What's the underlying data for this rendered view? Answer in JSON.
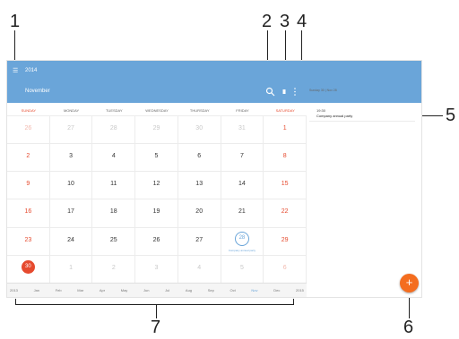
{
  "callouts": [
    "1",
    "2",
    "3",
    "4",
    "5",
    "6",
    "7"
  ],
  "app": {
    "menu_icon": "menu-icon",
    "year": "2014",
    "month": "November",
    "search_icon": "search-icon",
    "today_icon": "today-icon",
    "overflow_icon": "overflow-menu-icon",
    "accent_color": "#6aa5d9"
  },
  "calendar": {
    "weekdays": [
      "SUNDAY",
      "MONDAY",
      "TUESDAY",
      "WEDNESDAY",
      "THURSDAY",
      "FRIDAY",
      "SATURDAY"
    ],
    "weeks": [
      [
        "26",
        "27",
        "28",
        "29",
        "30",
        "31",
        "1"
      ],
      [
        "2",
        "3",
        "4",
        "5",
        "6",
        "7",
        "8"
      ],
      [
        "9",
        "10",
        "11",
        "12",
        "13",
        "14",
        "15"
      ],
      [
        "16",
        "17",
        "18",
        "19",
        "20",
        "21",
        "22"
      ],
      [
        "23",
        "24",
        "25",
        "26",
        "27",
        "28",
        "29"
      ],
      [
        "30",
        "1",
        "2",
        "3",
        "4",
        "5",
        "6"
      ]
    ],
    "today": "30",
    "event_day": "28",
    "event_short_label": "Company annual party"
  },
  "month_strip": [
    "2013",
    "Jan",
    "Feb",
    "Mar",
    "Apr",
    "May",
    "Jun",
    "Jul",
    "Aug",
    "Sep",
    "Oct",
    "Nov",
    "Dec",
    "2015"
  ],
  "side_panel": {
    "date_label": "Sunday 30 | Nov 28",
    "event_time": "19:30",
    "event_title": "Company annual party"
  },
  "fab": {
    "label": "+",
    "color": "#f46d1f"
  }
}
